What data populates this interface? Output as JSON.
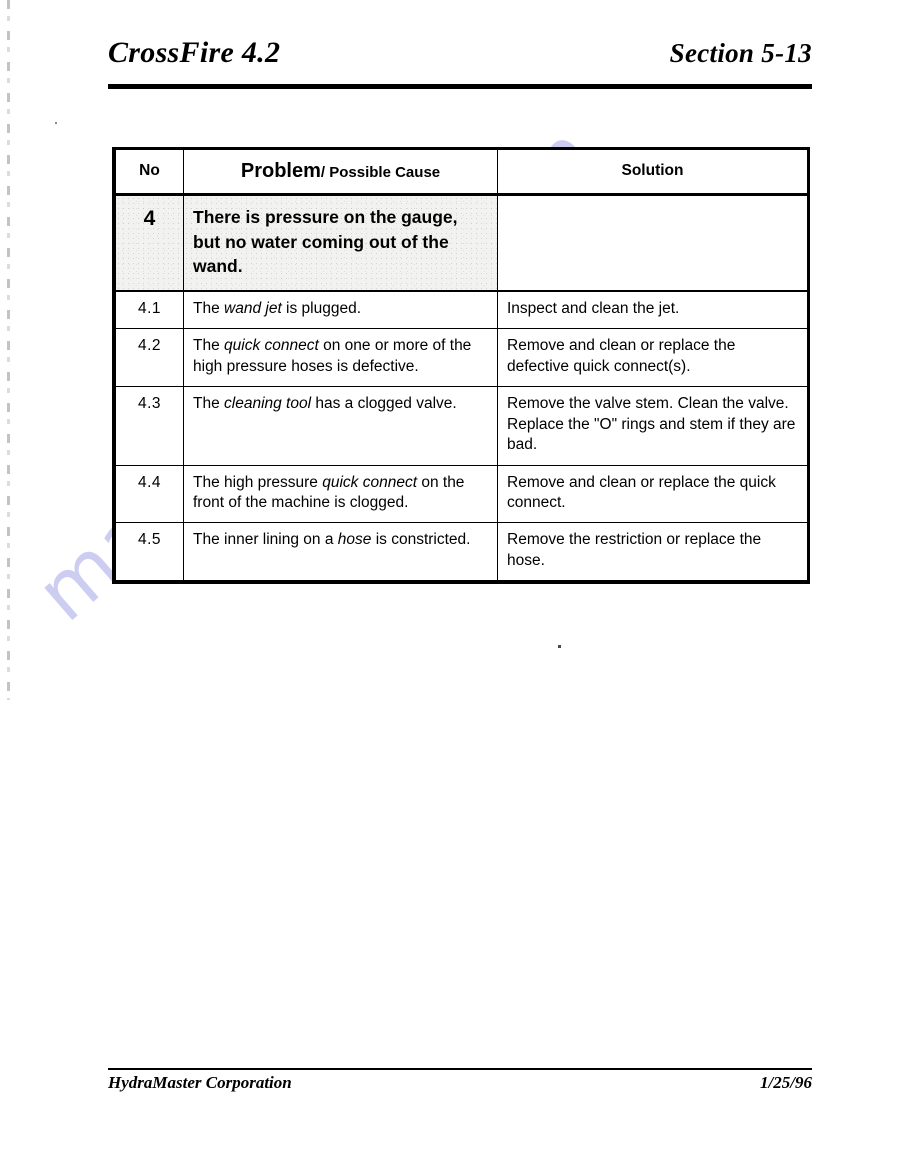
{
  "page": {
    "header": {
      "title": "CrossFire 4.2",
      "section": "Section 5-13"
    },
    "footer": {
      "company": "HydraMaster Corporation",
      "date": "1/25/96"
    },
    "watermark": "manualshive.com"
  },
  "table": {
    "columns": {
      "no": "No",
      "problem_main": "Problem",
      "problem_sub": "/ Possible Cause",
      "solution": "Solution"
    },
    "rows": [
      {
        "no": "4",
        "kind": "main",
        "problem_parts": [
          {
            "text": "There is pressure on the gauge, but no water coming out of the wand.",
            "italic": false
          }
        ],
        "solution": ""
      },
      {
        "no": "4.1",
        "kind": "sub",
        "problem_parts": [
          {
            "text": "The ",
            "italic": false
          },
          {
            "text": "wand jet",
            "italic": true
          },
          {
            "text": " is plugged.",
            "italic": false
          }
        ],
        "solution": "Inspect and clean the jet."
      },
      {
        "no": "4.2",
        "kind": "sub",
        "problem_parts": [
          {
            "text": "The ",
            "italic": false
          },
          {
            "text": "quick connect",
            "italic": true
          },
          {
            "text": " on one or more of the high pressure hoses is defective.",
            "italic": false
          }
        ],
        "solution": "Remove and clean or replace the defective quick connect(s)."
      },
      {
        "no": "4.3",
        "kind": "sub",
        "problem_parts": [
          {
            "text": "The ",
            "italic": false
          },
          {
            "text": "cleaning tool",
            "italic": true
          },
          {
            "text": " has a clogged valve.",
            "italic": false
          }
        ],
        "solution": "Remove the valve stem.  Clean the valve.  Replace the \"O\" rings and stem if they are bad."
      },
      {
        "no": "4.4",
        "kind": "sub",
        "problem_parts": [
          {
            "text": "The high pressure ",
            "italic": false
          },
          {
            "text": "quick connect",
            "italic": true
          },
          {
            "text": " on the front of the machine is clogged.",
            "italic": false
          }
        ],
        "solution": "Remove and clean or replace the quick connect."
      },
      {
        "no": "4.5",
        "kind": "sub",
        "problem_parts": [
          {
            "text": "The inner lining on a ",
            "italic": false
          },
          {
            "text": "hose",
            "italic": true
          },
          {
            "text": " is constricted.",
            "italic": false
          }
        ],
        "solution": "Remove the restriction or replace the hose."
      }
    ]
  }
}
